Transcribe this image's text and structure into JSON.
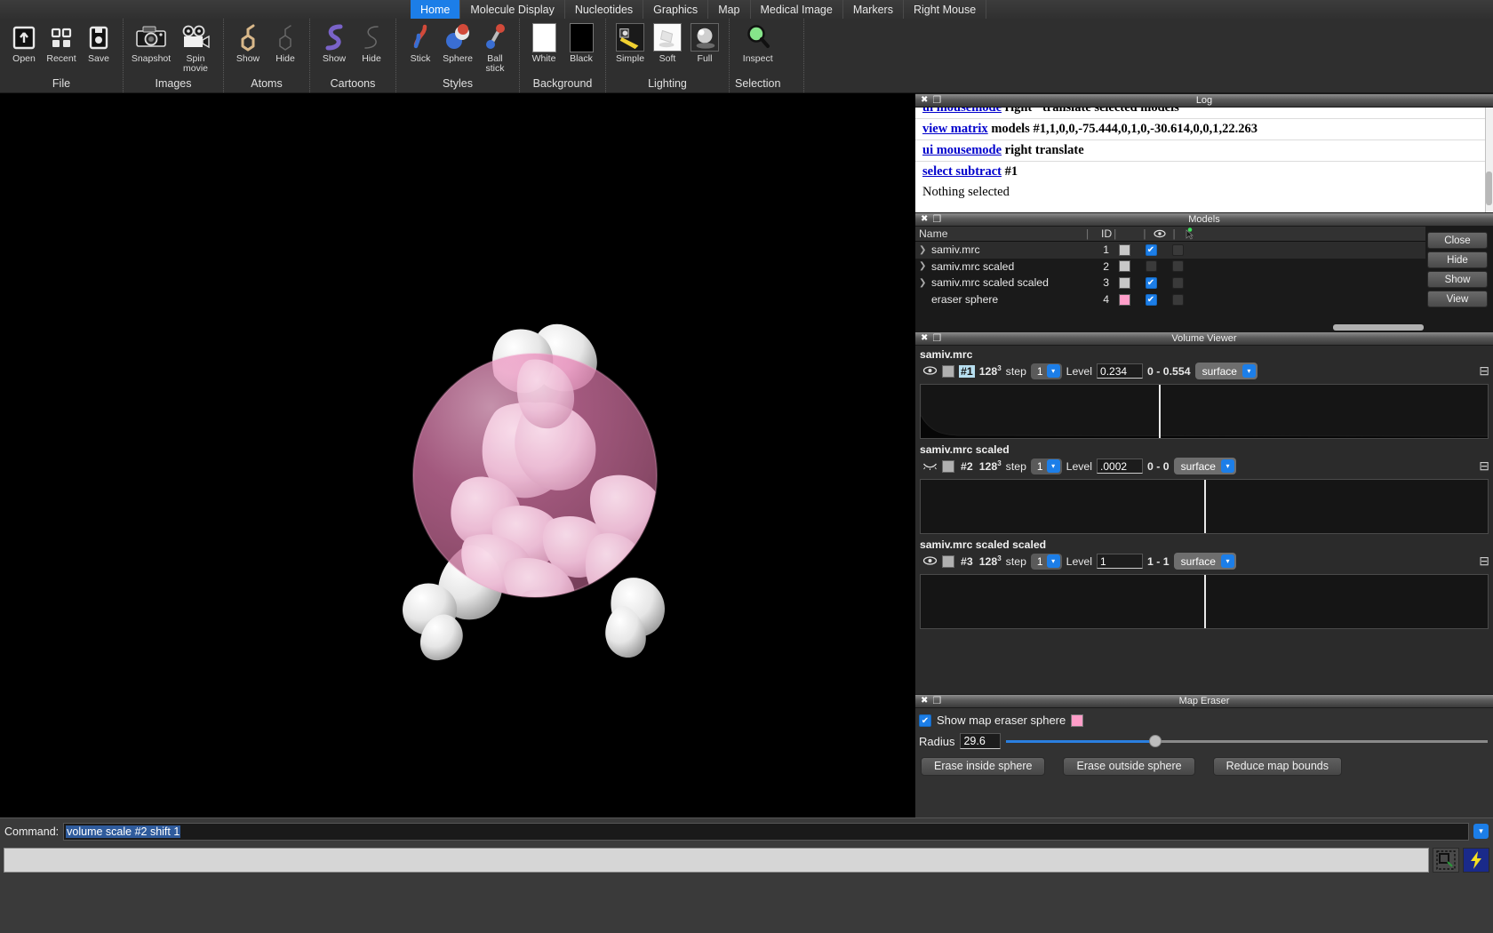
{
  "tabs": [
    {
      "label": "Home",
      "active": true
    },
    {
      "label": "Molecule Display",
      "active": false
    },
    {
      "label": "Nucleotides",
      "active": false
    },
    {
      "label": "Graphics",
      "active": false
    },
    {
      "label": "Map",
      "active": false
    },
    {
      "label": "Medical Image",
      "active": false
    },
    {
      "label": "Markers",
      "active": false
    },
    {
      "label": "Right Mouse",
      "active": false
    }
  ],
  "ribbon": {
    "groups": [
      {
        "name": "File",
        "items": [
          {
            "label": "Open",
            "icon": "open-folder-icon"
          },
          {
            "label": "Recent",
            "icon": "grid-recent-icon"
          },
          {
            "label": "Save",
            "icon": "save-disk-icon"
          }
        ]
      },
      {
        "name": "Images",
        "items": [
          {
            "label": "Snapshot",
            "icon": "camera-icon"
          },
          {
            "label": "Spin movie",
            "icon": "movie-camera-icon"
          }
        ]
      },
      {
        "name": "Atoms",
        "items": [
          {
            "label": "Show",
            "icon": "atoms-show-icon"
          },
          {
            "label": "Hide",
            "icon": "atoms-hide-icon"
          }
        ]
      },
      {
        "name": "Cartoons",
        "items": [
          {
            "label": "Show",
            "icon": "cartoon-show-icon"
          },
          {
            "label": "Hide",
            "icon": "cartoon-hide-icon"
          }
        ]
      },
      {
        "name": "Styles",
        "items": [
          {
            "label": "Stick",
            "icon": "stick-style-icon"
          },
          {
            "label": "Sphere",
            "icon": "sphere-style-icon"
          },
          {
            "label": "Ball stick",
            "icon": "ball-stick-style-icon"
          }
        ]
      },
      {
        "name": "Background",
        "items": [
          {
            "label": "White",
            "icon": "white-swatch-icon"
          },
          {
            "label": "Black",
            "icon": "black-swatch-icon"
          }
        ]
      },
      {
        "name": "Lighting",
        "items": [
          {
            "label": "Simple",
            "icon": "lighting-simple-icon"
          },
          {
            "label": "Soft",
            "icon": "lighting-soft-icon"
          },
          {
            "label": "Full",
            "icon": "lighting-full-icon"
          }
        ]
      },
      {
        "name": "Selection",
        "items": [
          {
            "label": "Inspect",
            "icon": "magnifier-inspect-icon"
          }
        ]
      }
    ]
  },
  "log": {
    "title": "Log",
    "entries": [
      {
        "cmd": "ui mousemode",
        "rest": " right \"translate selected models\"",
        "clipped": true
      },
      {
        "cmd": "view matrix",
        "rest": " models #1,1,0,0,-75.444,0,1,0,-30.614,0,0,1,22.263"
      },
      {
        "cmd": "ui mousemode",
        "rest": " right translate"
      },
      {
        "cmd": "select subtract",
        "rest": " #1"
      },
      {
        "plain": "Nothing selected"
      }
    ]
  },
  "models": {
    "title": "Models",
    "columns": [
      "Name",
      "ID",
      "",
      "eye-column",
      "pin-column"
    ],
    "rows": [
      {
        "name": "samiv.mrc",
        "id": "1",
        "color": "#c8c8c8",
        "shown": true,
        "pinned": false,
        "expandable": true,
        "selected": true
      },
      {
        "name": "samiv.mrc scaled",
        "id": "2",
        "color": "#c8c8c8",
        "shown": false,
        "pinned": false,
        "expandable": true,
        "selected": false
      },
      {
        "name": "samiv.mrc scaled scaled",
        "id": "3",
        "color": "#c8c8c8",
        "shown": true,
        "pinned": false,
        "expandable": true,
        "selected": false
      },
      {
        "name": "eraser sphere",
        "id": "4",
        "color": "#ff9ec9",
        "shown": true,
        "pinned": false,
        "expandable": false,
        "selected": false
      }
    ],
    "buttons": [
      "Close",
      "Hide",
      "Show",
      "View"
    ]
  },
  "volume_viewer": {
    "title": "Volume Viewer",
    "labels": {
      "step": "step",
      "level": "Level"
    },
    "maps": [
      {
        "name": "samiv.mrc",
        "visible": true,
        "id": "#1",
        "id_highlighted": true,
        "size": "128",
        "size_exp": "3",
        "step": "1",
        "level": "0.234",
        "range": "0 - 0.554",
        "style": "surface",
        "marker_pct": 42,
        "histogram": "full"
      },
      {
        "name": "samiv.mrc scaled",
        "visible": false,
        "id": "#2",
        "id_highlighted": false,
        "size": "128",
        "size_exp": "3",
        "step": "1",
        "level": ".0002",
        "range": "0 - 0",
        "style": "surface",
        "marker_pct": 50,
        "histogram": "flat"
      },
      {
        "name": "samiv.mrc scaled scaled",
        "visible": true,
        "id": "#3",
        "id_highlighted": false,
        "size": "128",
        "size_exp": "3",
        "step": "1",
        "level": "1",
        "range": "1 - 1",
        "style": "surface",
        "marker_pct": 50,
        "histogram": "flat"
      }
    ]
  },
  "map_eraser": {
    "title": "Map Eraser",
    "show_sphere_label": "Show map eraser sphere",
    "show_sphere_checked": true,
    "sphere_color": "#ff9ec9",
    "radius_label": "Radius",
    "radius_value": "29.6",
    "radius_slider_pct": 31,
    "buttons": [
      "Erase inside sphere",
      "Erase outside sphere",
      "Reduce map bounds"
    ]
  },
  "command": {
    "label": "Command:",
    "value": "volume scale #2 shift 1",
    "selected": true
  },
  "statusbar": {
    "message": "",
    "icons": [
      "select-region-icon",
      "lightning-icon"
    ]
  },
  "colors": {
    "accent": "#1c7ee8",
    "sphere_pink": "#e87fb4",
    "surface_white": "#e8e8e8",
    "background": "#000000"
  },
  "viewport": {
    "description": "3D molecular surface with translucent pink eraser sphere"
  }
}
